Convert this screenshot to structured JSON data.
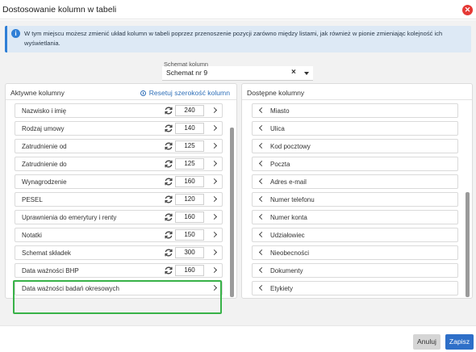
{
  "dialog": {
    "title": "Dostosowanie kolumn w tabeli"
  },
  "info": {
    "text": "W tym miejscu możesz zmienić układ kolumn w tabeli poprzez przenoszenie pozycji zarówno między listami, jak również w pionie zmieniając kolejność ich wyświetlania."
  },
  "schema": {
    "label": "Schemat kolumn",
    "value": "Schemat nr 9",
    "clear_icon": "×"
  },
  "active": {
    "title": "Aktywne kolumny",
    "reset_label": "Resetuj szerokość kolumn",
    "items": [
      {
        "label": "Nazwisko i imię",
        "width": "240"
      },
      {
        "label": "Rodzaj umowy",
        "width": "140"
      },
      {
        "label": "Zatrudnienie od",
        "width": "125"
      },
      {
        "label": "Zatrudnienie do",
        "width": "125"
      },
      {
        "label": "Wynagrodzenie",
        "width": "160"
      },
      {
        "label": "PESEL",
        "width": "120"
      },
      {
        "label": "Uprawnienia do emerytury i renty",
        "width": "160"
      },
      {
        "label": "Notatki",
        "width": "150"
      },
      {
        "label": "Schemat składek",
        "width": "300"
      },
      {
        "label": "Data ważności BHP",
        "width": "160"
      },
      {
        "label": "Data ważności badań okresowych",
        "width": ""
      }
    ]
  },
  "available": {
    "title": "Dostępne kolumny",
    "items": [
      {
        "label": "Miasto"
      },
      {
        "label": "Ulica"
      },
      {
        "label": "Kod pocztowy"
      },
      {
        "label": "Poczta"
      },
      {
        "label": "Adres e-mail"
      },
      {
        "label": "Numer telefonu"
      },
      {
        "label": "Numer konta"
      },
      {
        "label": "Udziałowiec"
      },
      {
        "label": "Nieobecności"
      },
      {
        "label": "Dokumenty"
      },
      {
        "label": "Etykiety"
      }
    ]
  },
  "footer": {
    "cancel_label": "Anuluj",
    "save_label": "Zapisz"
  },
  "colors": {
    "accent": "#2e6fc8",
    "highlight": "#38b248",
    "close": "#e53935",
    "info_bg": "#dde9f5"
  }
}
